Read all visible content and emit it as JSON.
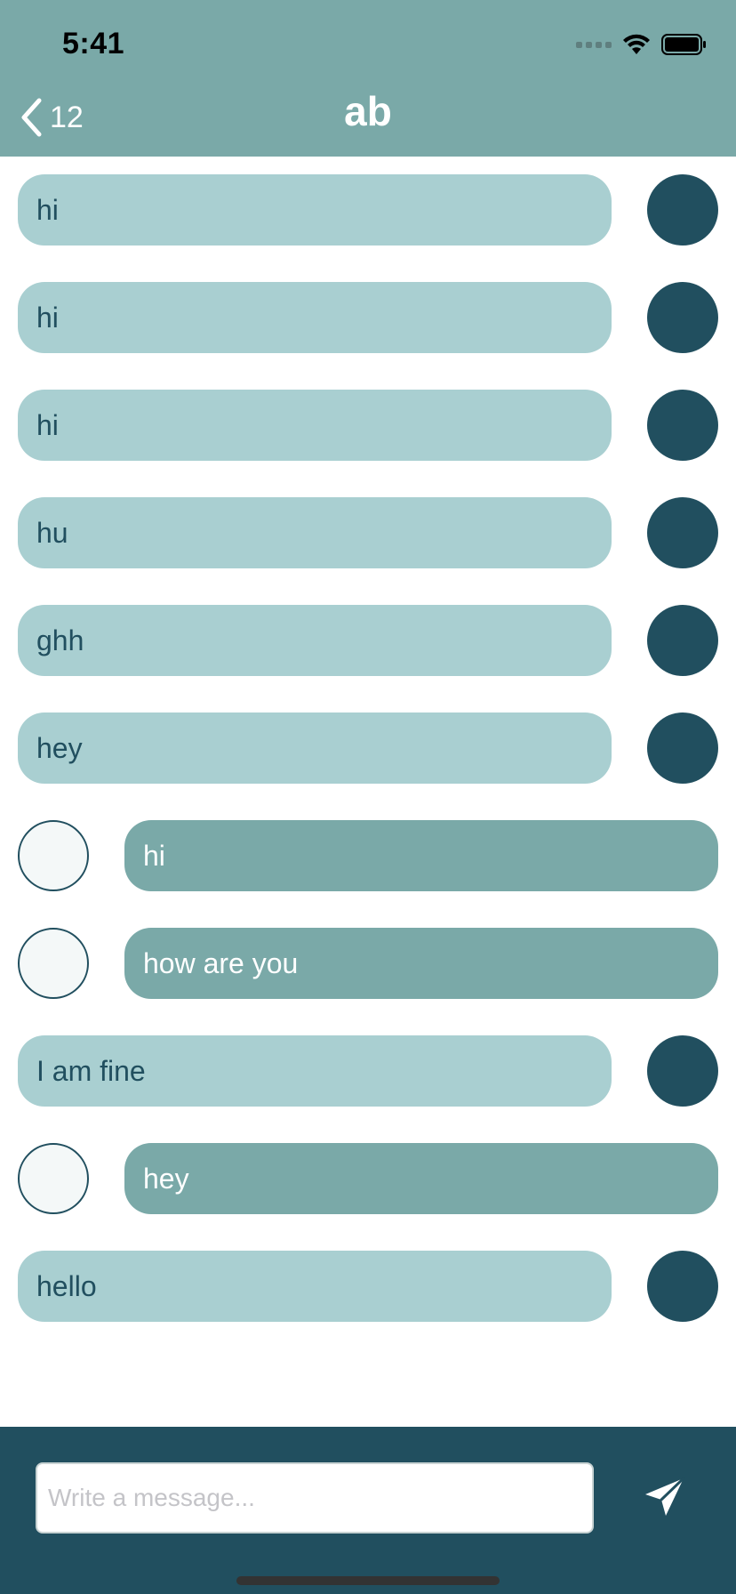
{
  "status_bar": {
    "time": "5:41",
    "icons": [
      "cellular-signal-icon",
      "wifi-icon",
      "battery-icon"
    ]
  },
  "nav": {
    "back_count": "12",
    "title": "ab",
    "back_icon": "chevron-left-icon"
  },
  "messages": [
    {
      "direction": "in",
      "text": "hi"
    },
    {
      "direction": "in",
      "text": "hi"
    },
    {
      "direction": "in",
      "text": "hi"
    },
    {
      "direction": "in",
      "text": "hu"
    },
    {
      "direction": "in",
      "text": "ghh"
    },
    {
      "direction": "in",
      "text": "hey"
    },
    {
      "direction": "out",
      "text": "hi"
    },
    {
      "direction": "out",
      "text": "how are you"
    },
    {
      "direction": "in",
      "text": "I am fine"
    },
    {
      "direction": "out",
      "text": "hey"
    },
    {
      "direction": "in",
      "text": "hello"
    }
  ],
  "composer": {
    "placeholder": "Write a message...",
    "value": "",
    "send_icon": "send-icon"
  },
  "colors": {
    "header_bg": "#7AA9A8",
    "incoming_bubble": "#A9CFD1",
    "outgoing_bubble": "#7AA9A8",
    "dark_teal": "#214F5F",
    "outgoing_avatar_fill": "#F4F8F8",
    "placeholder": "#C4C4C8"
  }
}
